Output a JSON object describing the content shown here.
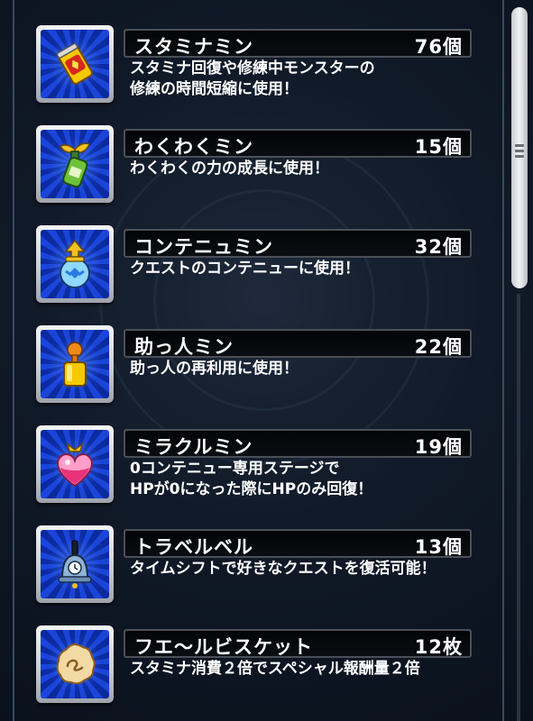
{
  "items": [
    {
      "name": "スタミナミン",
      "count": "76個",
      "desc": "スタミナ回復や修練中モンスターの\n修練の時間短縮に使用！",
      "icon": "stamina-can-icon"
    },
    {
      "name": "わくわくミン",
      "count": "15個",
      "desc": "わくわくの力の成長に使用！",
      "icon": "sprout-bottle-icon"
    },
    {
      "name": "コンテニュミン",
      "count": "32個",
      "desc": "クエストのコンテニューに使用！",
      "icon": "continue-jar-icon"
    },
    {
      "name": "助っ人ミン",
      "count": "22個",
      "desc": "助っ人の再利用に使用！",
      "icon": "helper-bottle-icon"
    },
    {
      "name": "ミラクルミン",
      "count": "19個",
      "desc": "0コンテニュー専用ステージで\nHPが0になった際にHPのみ回復！",
      "icon": "heart-potion-icon"
    },
    {
      "name": "トラベルベル",
      "count": "13個",
      "desc": "タイムシフトで好きなクエストを復活可能！",
      "icon": "bell-icon"
    },
    {
      "name": "フエ〜ルビスケット",
      "count": "12枚",
      "desc": "スタミナ消費２倍でスペシャル報酬量２倍",
      "icon": "biscuit-icon"
    }
  ],
  "colors": {
    "icon_bg": "#1a45d8",
    "name_bar_bg": "#030406",
    "text": "#ffffff"
  }
}
